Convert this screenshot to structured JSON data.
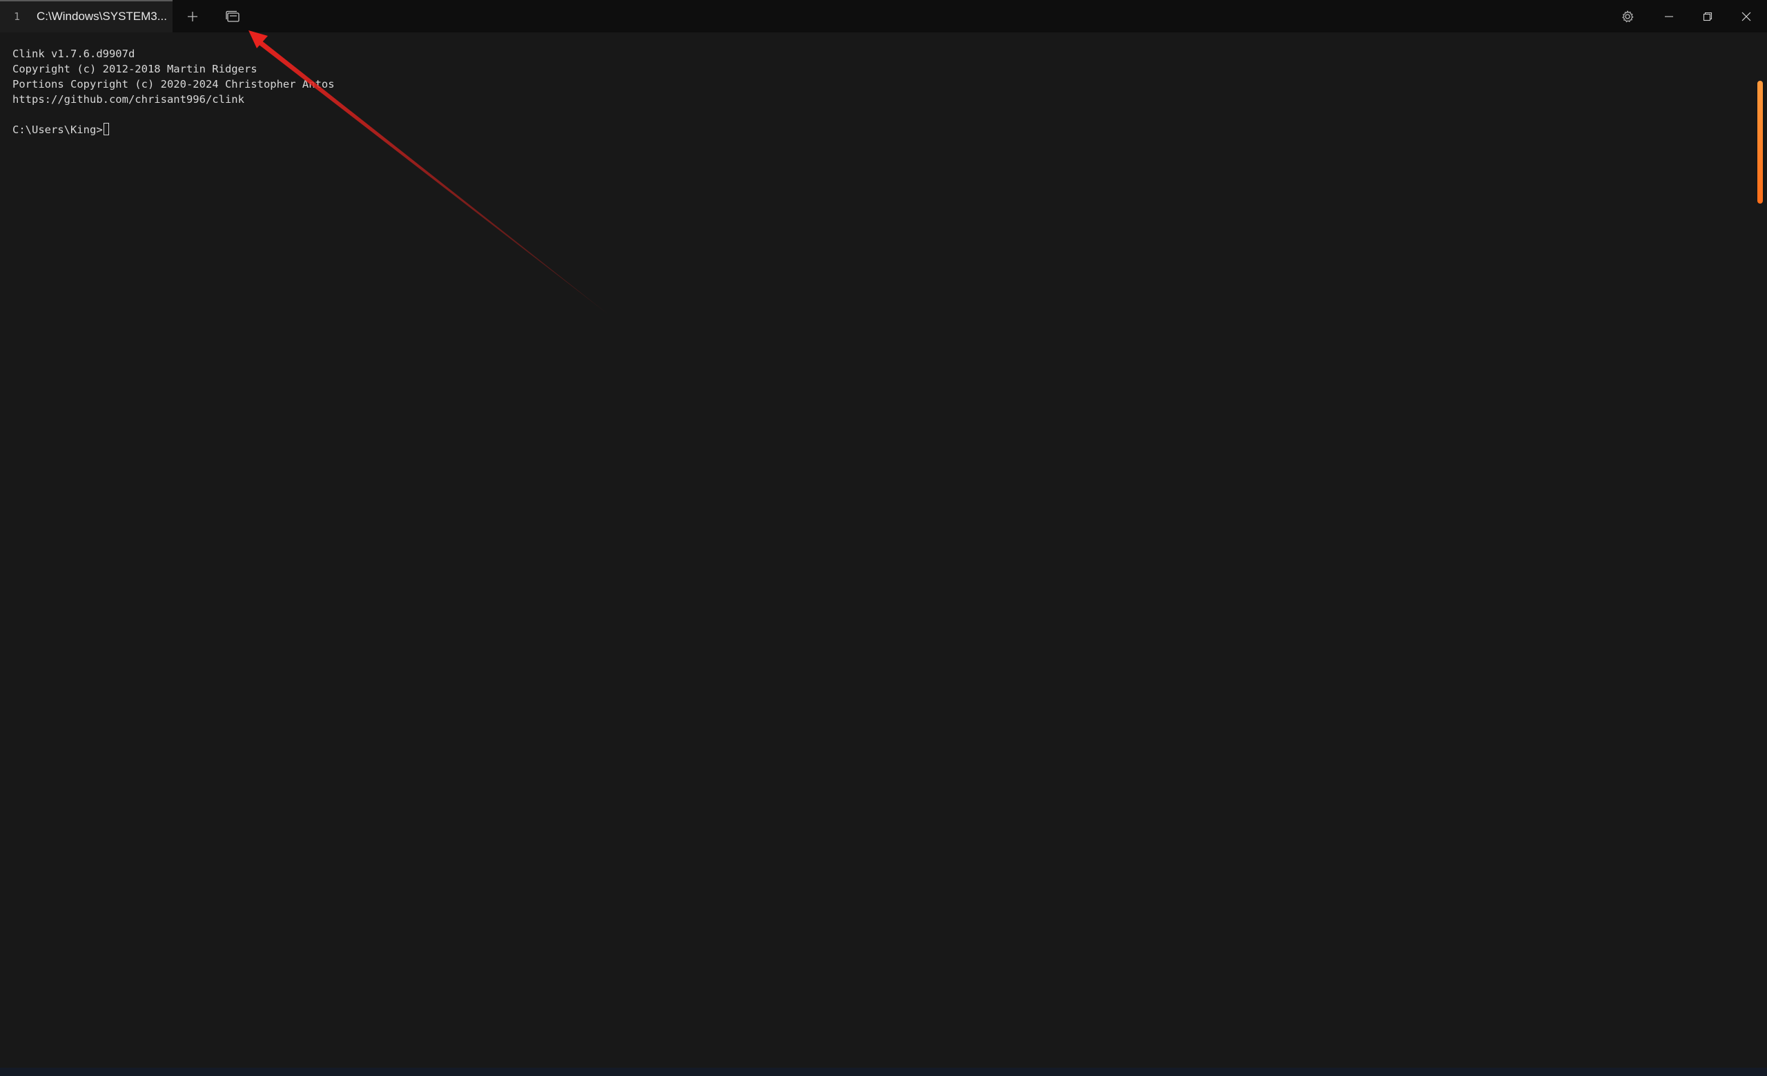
{
  "window": {
    "tab": {
      "number": "1",
      "title": "C:\\Windows\\SYSTEM3..."
    },
    "icons": {
      "new_tab": "plus-icon",
      "tab_switcher": "tab-switcher-icon",
      "settings": "gear-icon",
      "minimize": "minimize-icon",
      "maximize": "restore-icon",
      "close": "close-icon"
    }
  },
  "terminal": {
    "lines": [
      "Clink v1.7.6.d9907d",
      "Copyright (c) 2012-2018 Martin Ridgers",
      "Portions Copyright (c) 2020-2024 Christopher Antos",
      "https://github.com/chrisant996/clink"
    ],
    "prompt": "C:\\Users\\King>"
  },
  "colors": {
    "background": "#181818",
    "titlebar": "#0e0e0e",
    "text": "#d8d8d8",
    "scroll_thumb": "#ff7a20",
    "annotation_arrow": "#e8231e"
  },
  "annotation": {
    "type": "arrow",
    "target": "tab-switcher-icon"
  }
}
